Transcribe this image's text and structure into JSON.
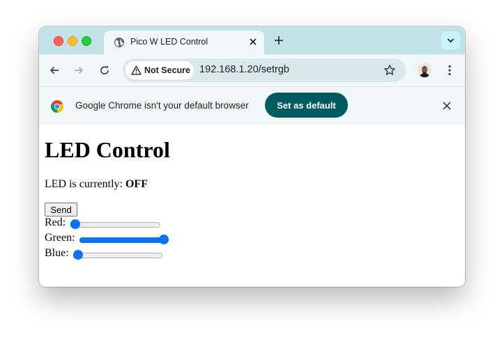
{
  "browser": {
    "tab_title": "Pico W LED Control",
    "security_label": "Not Secure",
    "url": "192.168.1.20/setrgb",
    "accent_color": "#005a62"
  },
  "infobar": {
    "message": "Google Chrome isn't your default browser",
    "button_label": "Set as default"
  },
  "page": {
    "heading": "LED Control",
    "status_prefix": "LED is currently:",
    "status_value": "OFF",
    "send_label": "Send",
    "sliders": [
      {
        "label": "Red:",
        "value_fraction": 0.0
      },
      {
        "label": "Green:",
        "value_fraction": 1.0
      },
      {
        "label": "Blue:",
        "value_fraction": 0.0
      }
    ]
  }
}
